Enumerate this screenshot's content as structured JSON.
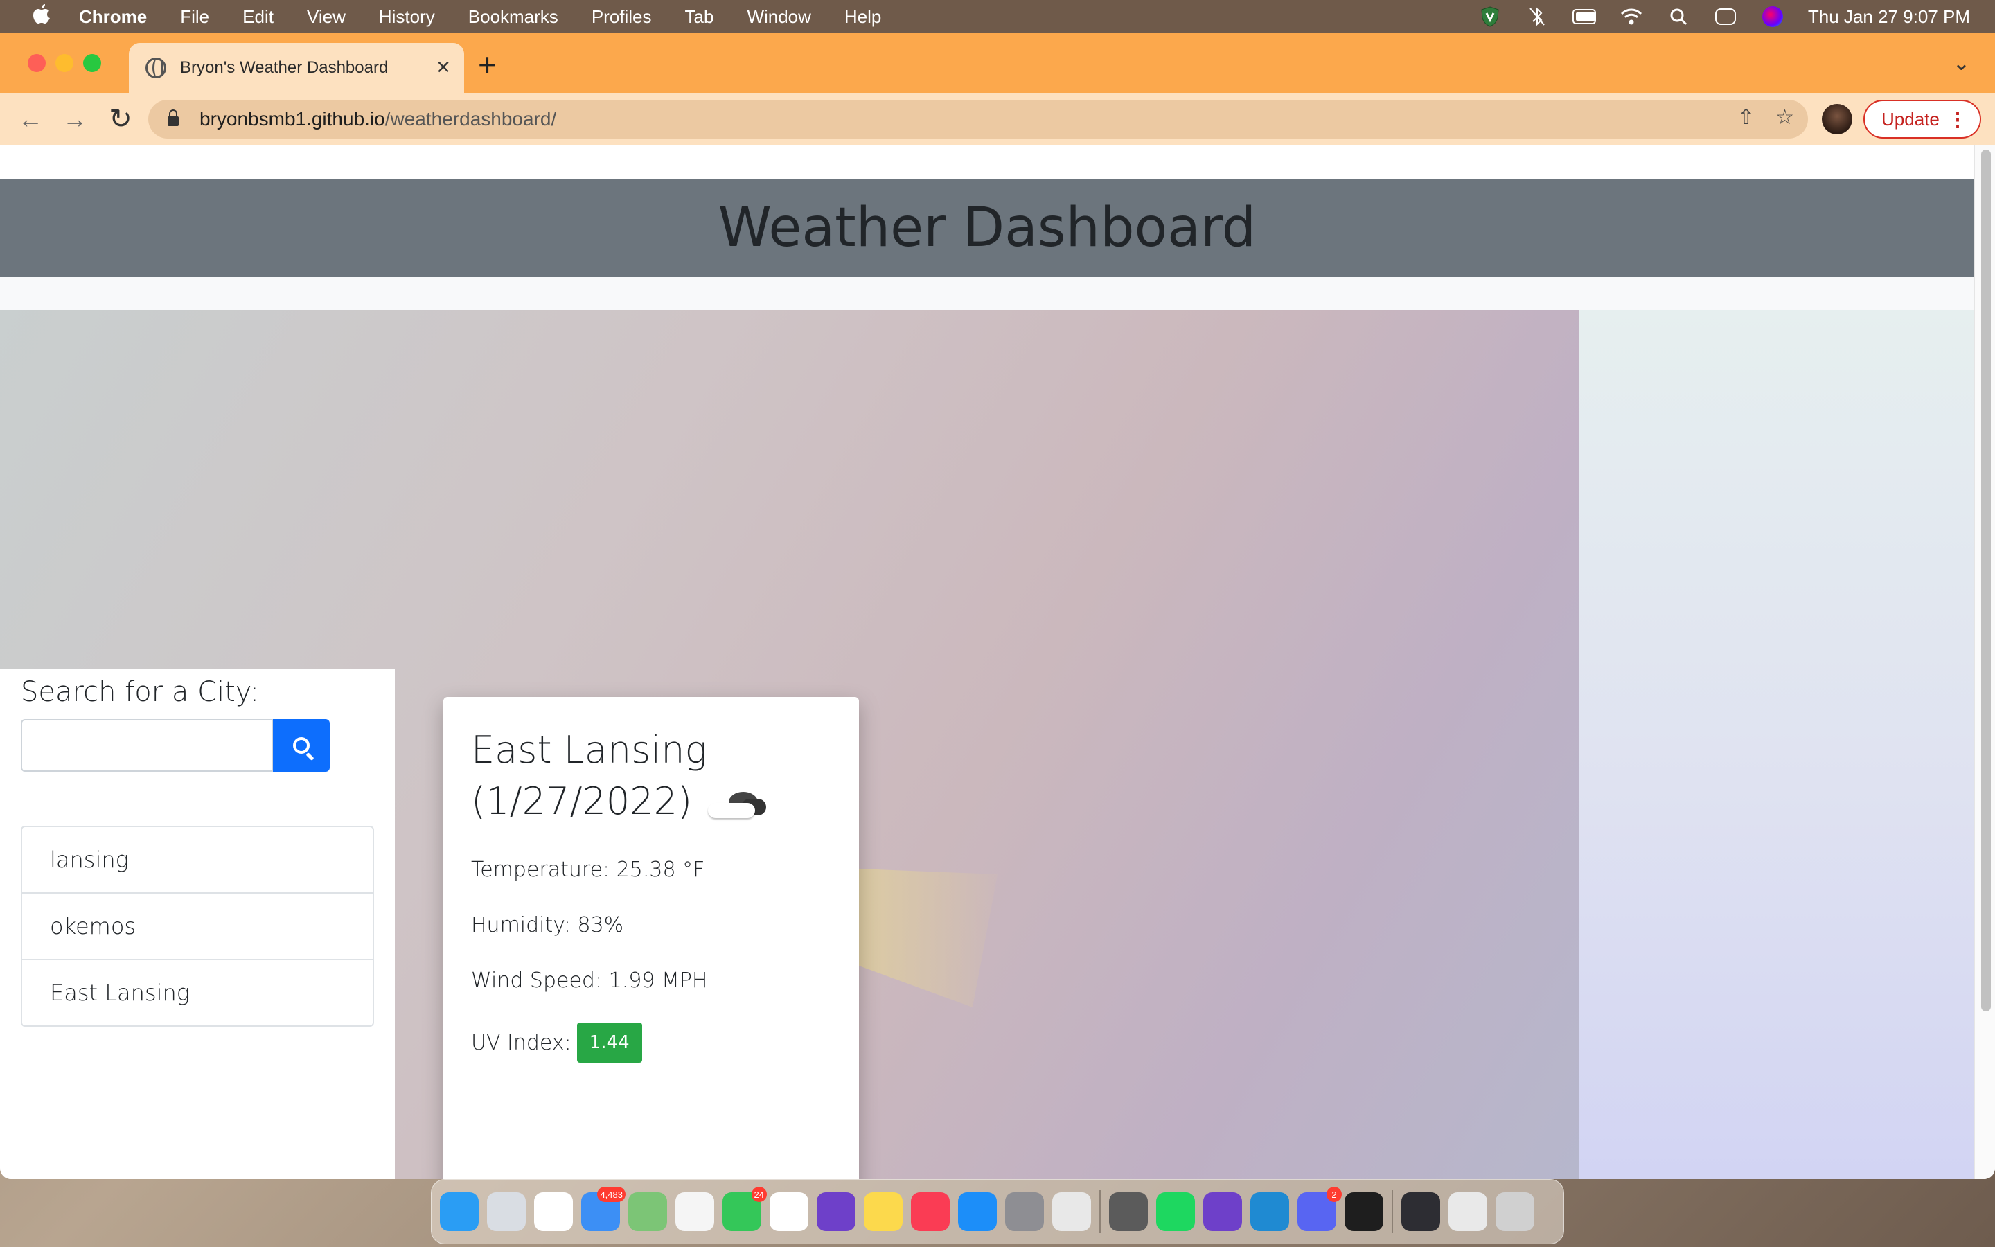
{
  "menubar": {
    "apple_icon": "apple-icon",
    "app_name": "Chrome",
    "items": [
      "File",
      "Edit",
      "View",
      "History",
      "Bookmarks",
      "Profiles",
      "Tab",
      "Window",
      "Help"
    ],
    "clock": "Thu Jan 27  9:07 PM",
    "status_icons": [
      "vpn-shield-icon",
      "bluetooth-off-icon",
      "battery-charging-icon",
      "wifi-icon",
      "search-icon",
      "control-center-icon",
      "siri-icon"
    ]
  },
  "browser": {
    "tab_title": "Bryon's Weather Dashboard",
    "url_host": "bryonbsmb1.github.io",
    "url_path": "/weatherdashboard/",
    "update_label": "Update"
  },
  "page": {
    "header_title": "Weather Dashboard",
    "search_label": "Search for a City:",
    "search_value": "",
    "history": [
      "lansing",
      "okemos",
      "East Lansing"
    ],
    "current": {
      "city_line1": "East Lansing",
      "city_line2": "(1/27/2022)",
      "weather_icon": "cloud-icon",
      "temperature": "Temperature: 25.38 °F",
      "humidity": "Humidity: 83%",
      "wind": "Wind Speed: 1.99 MPH",
      "uv_label": "UV Index:",
      "uv_value": "1.44",
      "uv_color": "#28a745"
    }
  },
  "dock": {
    "apps": [
      {
        "name": "finder",
        "color": "#2a9df4"
      },
      {
        "name": "launchpad",
        "color": "#d9dde3"
      },
      {
        "name": "slack",
        "color": "#ffffff"
      },
      {
        "name": "mail",
        "color": "#3c8ff5",
        "badge": "4,483"
      },
      {
        "name": "maps",
        "color": "#7cc576"
      },
      {
        "name": "photos",
        "color": "#f5f5f5"
      },
      {
        "name": "facetime",
        "color": "#34c759",
        "badge": "24"
      },
      {
        "name": "calendar",
        "color": "#ffffff"
      },
      {
        "name": "github-desktop",
        "color": "#6e40c9"
      },
      {
        "name": "notes",
        "color": "#fcd94c"
      },
      {
        "name": "music",
        "color": "#fa3c54"
      },
      {
        "name": "app-store",
        "color": "#1c8ef9"
      },
      {
        "name": "system-preferences",
        "color": "#8e8e93"
      },
      {
        "name": "chrome",
        "color": "#e8e8e8"
      },
      {
        "name": "color-picker",
        "color": "#5b5b5b"
      },
      {
        "name": "spotify",
        "color": "#1ed760"
      },
      {
        "name": "github",
        "color": "#6e40c9"
      },
      {
        "name": "vscode",
        "color": "#1f8ad2"
      },
      {
        "name": "discord",
        "color": "#5865f2",
        "badge": "2"
      },
      {
        "name": "terminal",
        "color": "#1e1e1e"
      },
      {
        "name": "window-thumbnail-1",
        "color": "#2d2d33"
      },
      {
        "name": "window-thumbnail-2",
        "color": "#e9e9e9"
      },
      {
        "name": "trash",
        "color": "#d0d0d0"
      }
    ]
  }
}
